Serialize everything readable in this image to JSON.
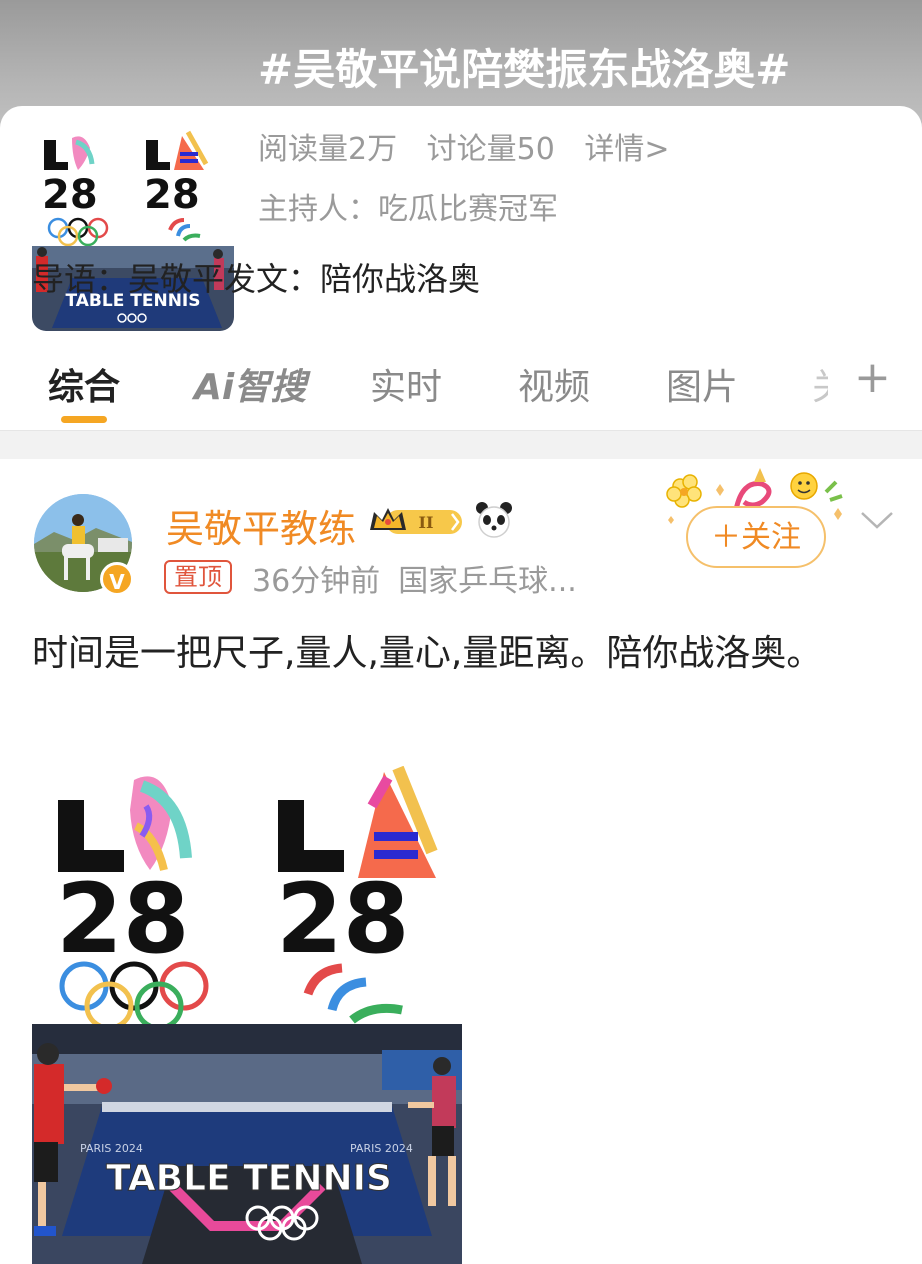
{
  "topic": {
    "title": "#吴敬平说陪樊振东战洛奥#",
    "reads": "阅读量2万",
    "discussions": "讨论量50",
    "details": "详情>",
    "host": "主持人：吃瓜比赛冠军",
    "guide": "导语：吴敬平发文：陪你战洛奥",
    "thumb_caption": "TABLE TENNIS"
  },
  "tabs": [
    {
      "label": "综合",
      "active": true
    },
    {
      "label": "Ai智搜",
      "active": false
    },
    {
      "label": "实时",
      "active": false
    },
    {
      "label": "视频",
      "active": false
    },
    {
      "label": "图片",
      "active": false
    },
    {
      "label": "关",
      "active": false
    }
  ],
  "tab_add_symbol": "+",
  "post": {
    "author": "吴敬平教练",
    "member_level": "II",
    "pinned": "置顶",
    "time": "36分钟前",
    "source": "国家乒乓球...",
    "follow": "＋关注",
    "verified_mark": "V",
    "text": "时间是一把尺子,量人,量心,量距离。陪你战洛奥。",
    "image_logo_left": "LA28",
    "image_logo_right": "LA28",
    "image_caption": "TABLE TENNIS",
    "image_watermark": "PARIS 2024"
  },
  "colors": {
    "accent": "#f5a623",
    "author": "#f08a24",
    "pin": "#e0553c",
    "muted": "#9a9a9a",
    "text": "#222222"
  },
  "icons": [
    "crown-badge-icon",
    "panda-icon",
    "chevron-down-icon",
    "plus-icon",
    "verified-icon"
  ]
}
